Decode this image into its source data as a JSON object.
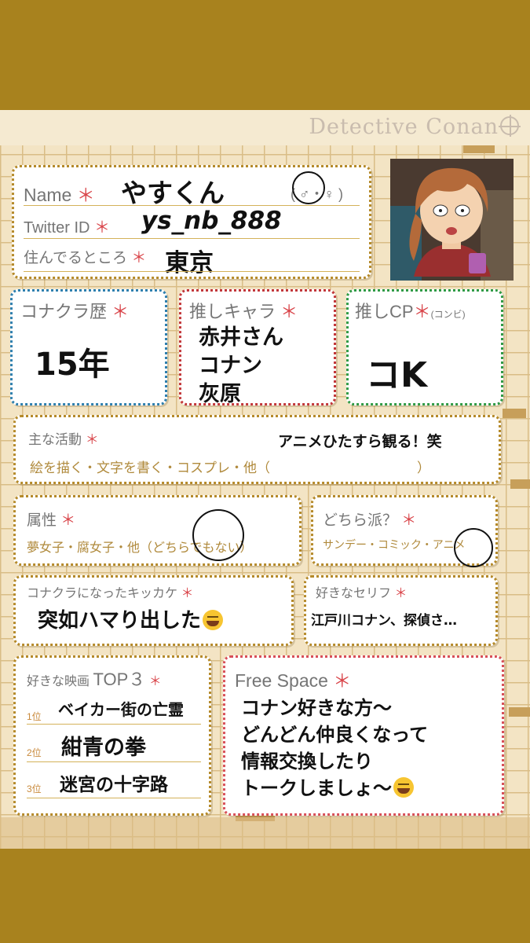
{
  "header": {
    "brand": "Detective Conan"
  },
  "profile": {
    "name_label": "Name",
    "name_value": "やすくん",
    "gender_option": "( ♂・♀ )",
    "twitter_label": "Twitter ID",
    "twitter_value": "ys_nb_888",
    "location_label": "住んでるところ",
    "location_value": "東京",
    "star": "＊"
  },
  "history": {
    "label": "コナクラ歴",
    "value": "15年"
  },
  "favorite_character": {
    "label": "推しキャラ",
    "values": [
      "赤井さん",
      "コナン",
      "灰原"
    ]
  },
  "favorite_cp": {
    "label": "推しCP",
    "sublabel": "(コンビ)",
    "value": "コK"
  },
  "activities": {
    "label": "主な活動",
    "options": "絵を描く・文字を書く・コスプレ・他（　　　　　　　　　　　）",
    "answer": "アニメひたすら観る！笑"
  },
  "attribute": {
    "label": "属性",
    "options": "夢女子・腐女子・他（どちらでもない）"
  },
  "which_side": {
    "label": "どちら派？",
    "options": "サンデー・コミック・アニメ"
  },
  "trigger": {
    "label": "コナクラになったキッカケ",
    "answer": "突如ハマり出した"
  },
  "favorite_line": {
    "label": "好きなセリフ",
    "answer": "江戸川コナン、探偵さ…"
  },
  "movies": {
    "label": "好きな映画",
    "label_top": "TOP３",
    "ranks": [
      "1位",
      "2位",
      "3位"
    ],
    "titles": [
      "ベイカー街の亡霊",
      "紺青の拳",
      "迷宮の十字路"
    ]
  },
  "free_space": {
    "label": "Free Space",
    "lines": [
      "コナン好きな方〜",
      "どんどん仲良くなって",
      "情報交換したり",
      "トークしましょ〜"
    ]
  },
  "colors": {
    "page_background": "#a8821e",
    "sheet": "#f3e4c4",
    "accent_star": "#d9464b"
  },
  "icons": [
    "laughing-emoji-icon",
    "smiling-emoji-icon",
    "conan-crosshair-icon"
  ]
}
